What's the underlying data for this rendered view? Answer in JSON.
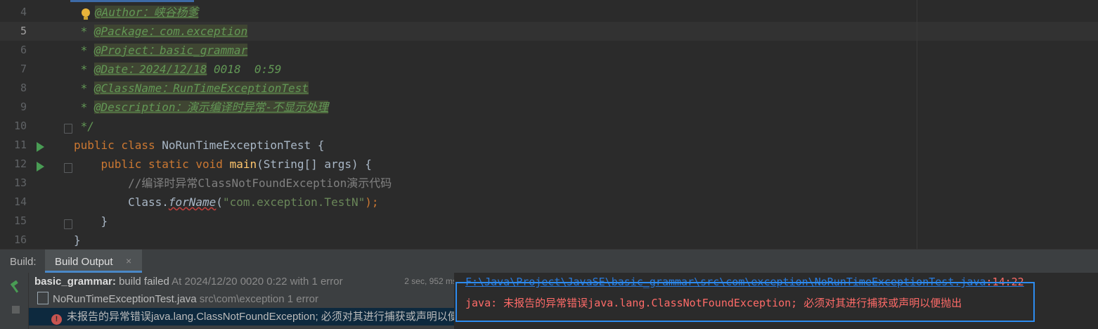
{
  "editor": {
    "lines": [
      {
        "num": "4",
        "parts": [
          {
            "t": "@Author：峡谷杨爹",
            "c": "tag"
          }
        ]
      },
      {
        "num": "5",
        "parts": [
          {
            "t": " * ",
            "c": "doc"
          },
          {
            "t": "@Package：com.exception",
            "c": "tag"
          }
        ]
      },
      {
        "num": "6",
        "parts": [
          {
            "t": " * ",
            "c": "doc"
          },
          {
            "t": "@Project：basic_grammar",
            "c": "tag"
          }
        ]
      },
      {
        "num": "7",
        "parts": [
          {
            "t": " * ",
            "c": "doc"
          },
          {
            "t": "@Date：2024/12/18",
            "c": "tag"
          },
          {
            "t": " 0018  0:59",
            "c": "doc"
          }
        ]
      },
      {
        "num": "8",
        "parts": [
          {
            "t": " * ",
            "c": "doc"
          },
          {
            "t": "@ClassName：RunTimeExceptionTest",
            "c": "tag"
          }
        ]
      },
      {
        "num": "9",
        "parts": [
          {
            "t": " * ",
            "c": "doc"
          },
          {
            "t": "@Description：演示编译时异常-不显示处理",
            "c": "tag"
          }
        ]
      },
      {
        "num": "10",
        "parts": [
          {
            "t": " */",
            "c": "doc"
          }
        ]
      },
      {
        "num": "11",
        "parts": [
          {
            "t": "public class ",
            "c": "kw"
          },
          {
            "t": "NoRunTimeExceptionTest {",
            "c": ""
          }
        ]
      },
      {
        "num": "12",
        "parts": [
          {
            "t": "    public static void ",
            "c": "kw"
          },
          {
            "t": "main",
            "c": "fn"
          },
          {
            "t": "(String[] args) {",
            "c": ""
          }
        ]
      },
      {
        "num": "13",
        "parts": [
          {
            "t": "        //编译时异常ClassNotFoundException演示代码",
            "c": "cmt"
          }
        ]
      },
      {
        "num": "14",
        "parts": [
          {
            "t": "        Class.",
            "c": ""
          },
          {
            "t": "forName",
            "c": "stat"
          },
          {
            "t": "(",
            "c": ""
          },
          {
            "t": "\"com.exception.TestN\"",
            "c": "str"
          },
          {
            "t": ");",
            "c": "kw"
          }
        ]
      },
      {
        "num": "15",
        "parts": [
          {
            "t": "    }",
            "c": ""
          }
        ]
      },
      {
        "num": "16",
        "parts": [
          {
            "t": "}",
            "c": ""
          }
        ]
      }
    ]
  },
  "build": {
    "title": "Build:",
    "tab_label": "Build Output",
    "tab_close": "×",
    "tree": {
      "project": "basic_grammar:",
      "status": " build failed",
      "when": " At 2024/12/20 0020 0:22 with 1 error",
      "duration": "2 sec, 952 ms",
      "file": "NoRunTimeExceptionTest.java",
      "file_path": " src\\com\\exception 1 error",
      "error_icon": "!",
      "error": "未报告的异常错误java.lang.ClassNotFoundException; 必须对其进行捕获或声明以便抛出"
    },
    "console": {
      "path": "F:\\Java\\Project\\JavaSE\\basic_grammar\\src\\com\\exception\\NoRunTimeExceptionTest.java",
      "position": ":14:22",
      "message": "java: 未报告的异常错误java.lang.ClassNotFoundException; 必须对其进行捕获或声明以便抛出"
    }
  },
  "colors": {
    "accent": "#4a88c7",
    "error": "#ff6b68",
    "highlight_box": "#2d8cf0"
  }
}
